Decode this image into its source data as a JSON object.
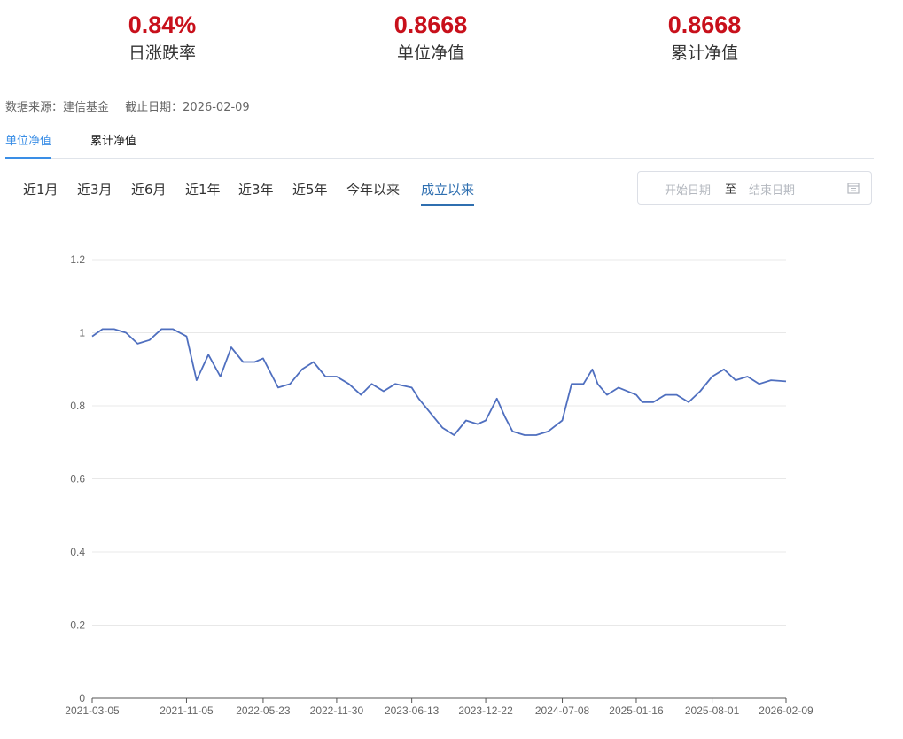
{
  "summary": [
    {
      "value": "0.84%",
      "label": "日涨跌率"
    },
    {
      "value": "0.8668",
      "label": "单位净值"
    },
    {
      "value": "0.8668",
      "label": "累计净值"
    }
  ],
  "source": {
    "source_text": "数据来源：建信基金",
    "cutoff_text": "截止日期：2026-02-09"
  },
  "value_tabs": [
    {
      "label": "单位净值",
      "active": true
    },
    {
      "label": "累计净值",
      "active": false
    }
  ],
  "range_tabs": [
    {
      "label": "近1月",
      "active": false
    },
    {
      "label": "近3月",
      "active": false
    },
    {
      "label": "近6月",
      "active": false
    },
    {
      "label": "近1年",
      "active": false
    },
    {
      "label": "近3年",
      "active": false
    },
    {
      "label": "近5年",
      "active": false
    },
    {
      "label": "今年以来",
      "active": false
    },
    {
      "label": "成立以来",
      "active": true
    }
  ],
  "date_range": {
    "start_placeholder": "开始日期",
    "separator": "至",
    "end_placeholder": "结束日期",
    "icon": "calendar-icon"
  },
  "colors": {
    "accent": "#c8101b",
    "tab_active": "#3a8ee6",
    "range_active": "#2f6fb0",
    "line": "#4f6fbf"
  },
  "chart_data": {
    "type": "line",
    "title": "",
    "xlabel": "",
    "ylabel": "",
    "x_ticks": [
      "2021-03-05",
      "2021-11-05",
      "2022-05-23",
      "2022-11-30",
      "2023-06-13",
      "2023-12-22",
      "2024-07-08",
      "2025-01-16",
      "2025-08-01",
      "2026-02-09"
    ],
    "y_ticks": [
      "0",
      "0.2",
      "0.4",
      "0.6",
      "0.8",
      "1",
      "1.2"
    ],
    "ylim": [
      0,
      1.2
    ],
    "grid": true,
    "series": [
      {
        "x": [
          "2021-03-05",
          "2021-04-01",
          "2021-05-01",
          "2021-06-01",
          "2021-07-01",
          "2021-08-01",
          "2021-09-01",
          "2021-10-01",
          "2021-11-05",
          "2021-12-01",
          "2022-01-01",
          "2022-02-01",
          "2022-03-01",
          "2022-04-01",
          "2022-05-01",
          "2022-05-23",
          "2022-07-01",
          "2022-08-01",
          "2022-09-01",
          "2022-10-01",
          "2022-11-01",
          "2022-11-30",
          "2023-01-01",
          "2023-02-01",
          "2023-03-01",
          "2023-04-01",
          "2023-05-01",
          "2023-06-13",
          "2023-07-01",
          "2023-08-01",
          "2023-09-01",
          "2023-10-01",
          "2023-11-01",
          "2023-12-01",
          "2023-12-22",
          "2024-01-20",
          "2024-02-10",
          "2024-03-01",
          "2024-04-01",
          "2024-05-01",
          "2024-06-01",
          "2024-07-08",
          "2024-08-01",
          "2024-09-01",
          "2024-09-24",
          "2024-10-08",
          "2024-11-01",
          "2024-12-01",
          "2025-01-16",
          "2025-02-01",
          "2025-03-01",
          "2025-04-01",
          "2025-05-01",
          "2025-06-01",
          "2025-07-01",
          "2025-08-01",
          "2025-09-01",
          "2025-10-01",
          "2025-11-01",
          "2025-12-01",
          "2026-01-01",
          "2026-02-09"
        ],
        "values": [
          0.99,
          1.01,
          1.01,
          1.0,
          0.97,
          0.98,
          1.01,
          1.01,
          0.99,
          0.87,
          0.94,
          0.88,
          0.96,
          0.92,
          0.92,
          0.93,
          0.85,
          0.86,
          0.9,
          0.92,
          0.88,
          0.88,
          0.86,
          0.83,
          0.86,
          0.84,
          0.86,
          0.85,
          0.82,
          0.78,
          0.74,
          0.72,
          0.76,
          0.75,
          0.76,
          0.82,
          0.77,
          0.73,
          0.72,
          0.72,
          0.73,
          0.76,
          0.86,
          0.86,
          0.9,
          0.86,
          0.83,
          0.85,
          0.83,
          0.81,
          0.81,
          0.83,
          0.83,
          0.81,
          0.84,
          0.88,
          0.9,
          0.87,
          0.88,
          0.86,
          0.87,
          0.8668
        ]
      }
    ]
  }
}
